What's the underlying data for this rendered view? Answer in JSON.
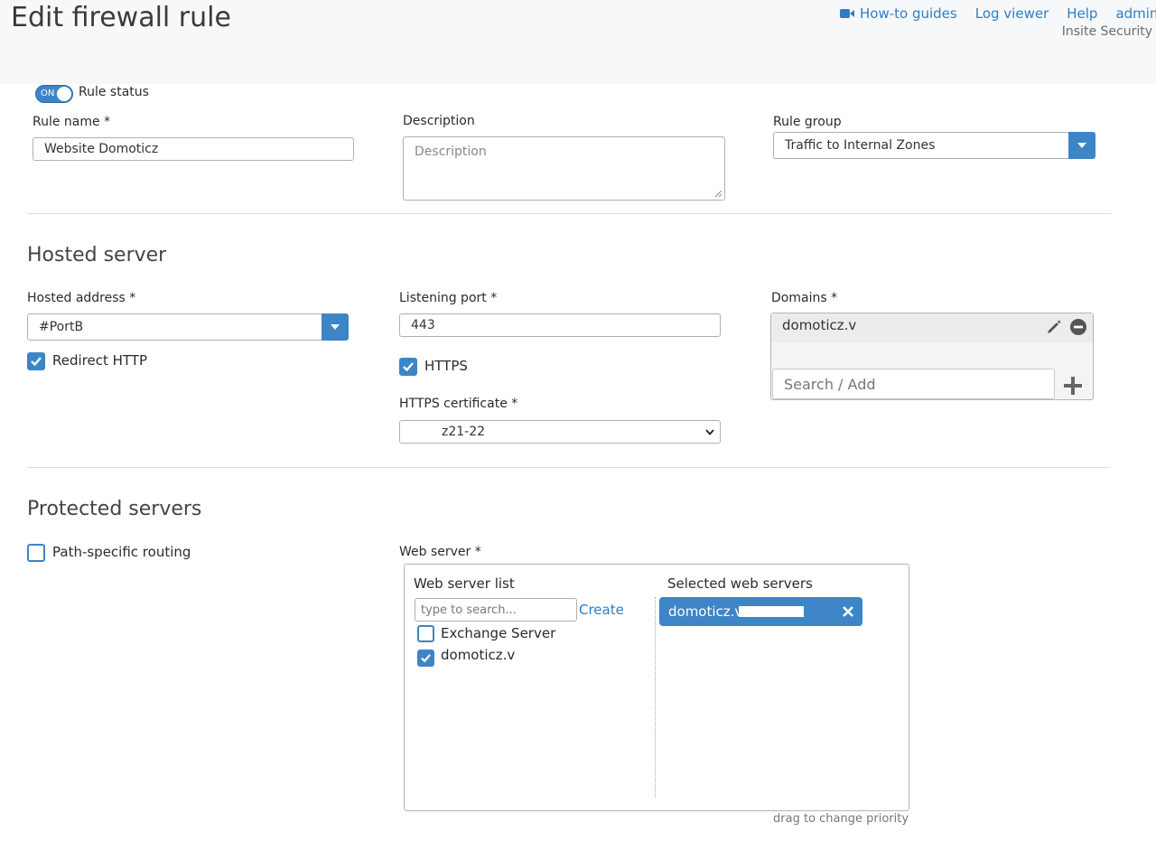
{
  "header": {
    "title": "Edit firewall rule",
    "nav": [
      {
        "label": "How-to guides",
        "icon": "video-camera-icon"
      },
      {
        "label": "Log viewer"
      },
      {
        "label": "Help"
      },
      {
        "label": "admin"
      }
    ],
    "organization": "Insite Security"
  },
  "rule": {
    "status_toggle": "ON",
    "status_label": "Rule status",
    "name_label": "Rule name *",
    "name_value": "Website Domoticz",
    "description_label": "Description",
    "description_placeholder": "Description",
    "group_label": "Rule group",
    "group_value": "Traffic to Internal Zones"
  },
  "hosted_server": {
    "title": "Hosted server",
    "address_label": "Hosted address *",
    "address_value": "#PortB",
    "redirect_http_label": "Redirect HTTP",
    "redirect_http_checked": true,
    "port_label": "Listening port *",
    "port_value": "443",
    "https_label": "HTTPS",
    "https_checked": true,
    "cert_label": "HTTPS certificate *",
    "cert_value": "z21-22",
    "domains_label": "Domains *",
    "domain_entry": "domoticz.v",
    "domain_search_placeholder": "Search / Add"
  },
  "protected_servers": {
    "title": "Protected servers",
    "path_routing_label": "Path-specific routing",
    "path_routing_checked": false,
    "web_server_label": "Web server *",
    "list_title": "Web server list",
    "search_placeholder": "type to search...",
    "create_label": "Create",
    "list_items": [
      {
        "label": "Exchange Server",
        "checked": false
      },
      {
        "label": "domoticz.v",
        "checked": true
      }
    ],
    "selected_title": "Selected web servers",
    "selected_items": [
      "domoticz.v"
    ],
    "drag_hint": "drag to change priority"
  },
  "colors": {
    "accent": "#3d85c6",
    "link": "#2f7ec5"
  }
}
